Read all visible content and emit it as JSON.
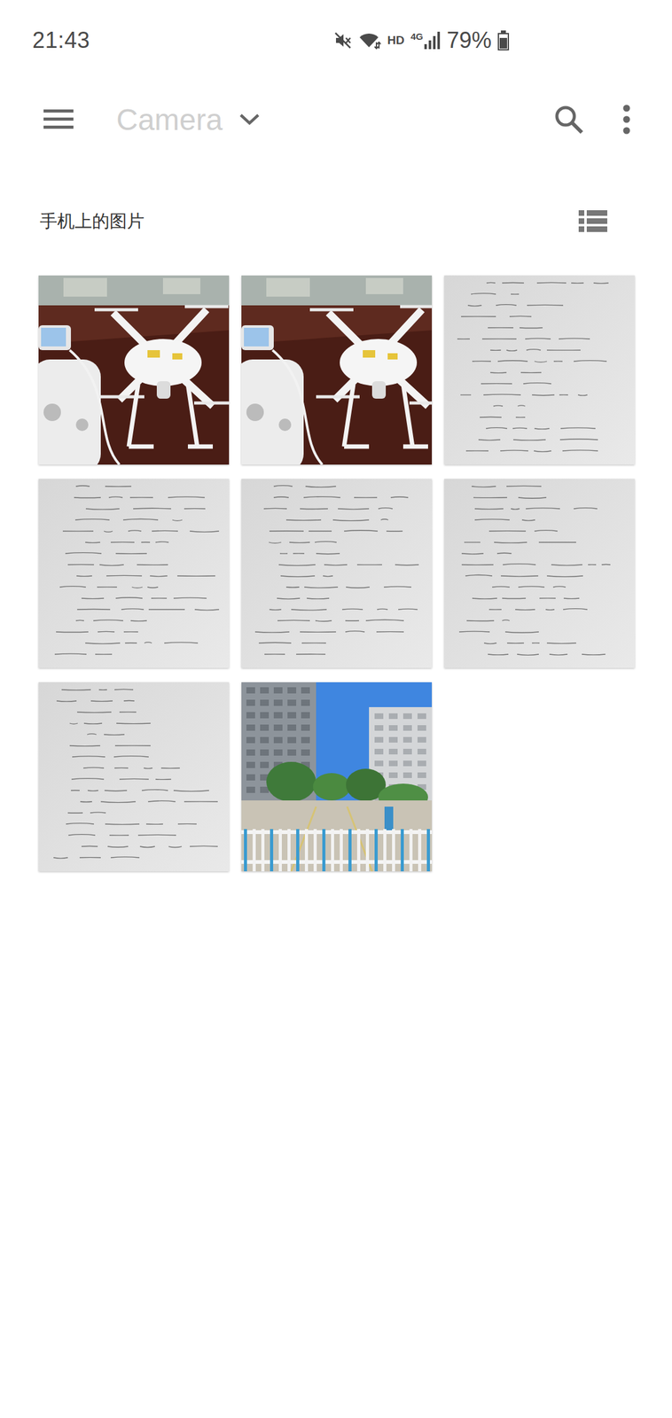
{
  "status_bar": {
    "time": "21:43",
    "hd": "HD",
    "network": "4G",
    "battery": "79%",
    "battery_level": 0.79
  },
  "toolbar": {
    "title": "Camera"
  },
  "section": {
    "title": "手机上的图片"
  },
  "photos": [
    {
      "kind": "drone"
    },
    {
      "kind": "drone"
    },
    {
      "kind": "notes"
    },
    {
      "kind": "notes"
    },
    {
      "kind": "notes"
    },
    {
      "kind": "notes"
    },
    {
      "kind": "notes"
    },
    {
      "kind": "street"
    }
  ]
}
